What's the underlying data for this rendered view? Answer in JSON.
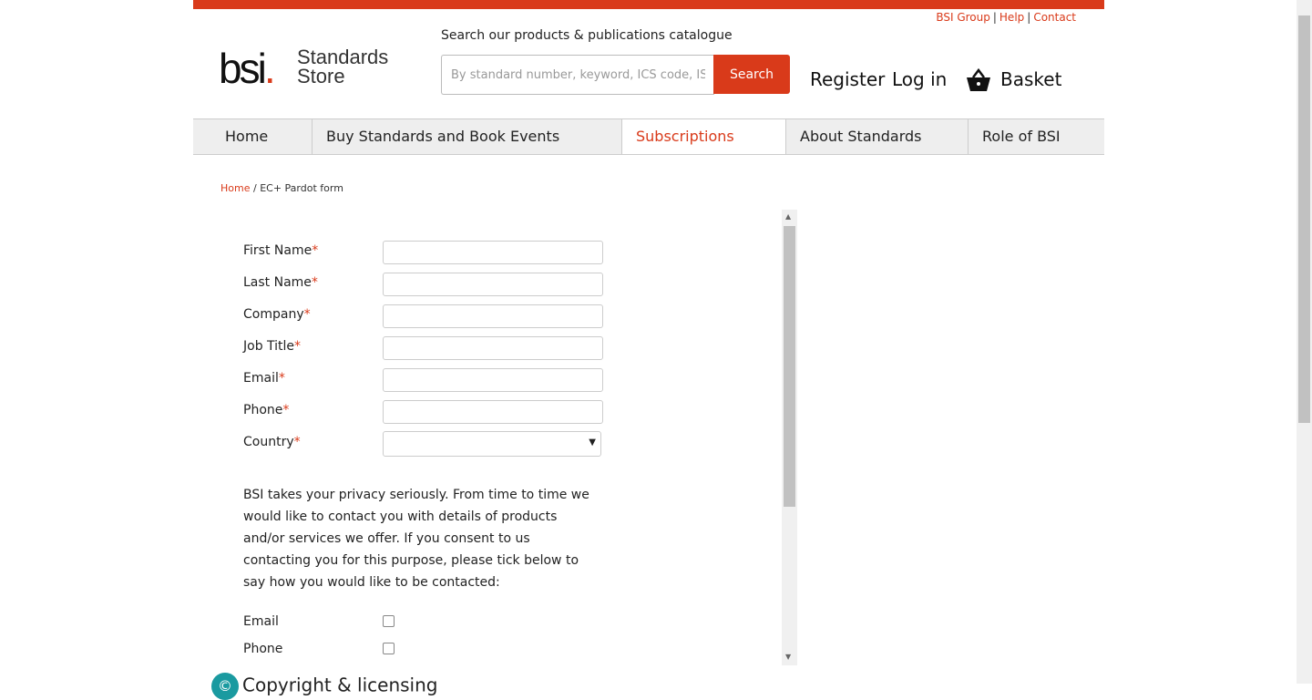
{
  "top_links": [
    "BSI Group",
    "Help",
    "Contact"
  ],
  "logo": {
    "bsi": "bsi",
    "dot": ".",
    "line1": "Standards",
    "line2": "Store"
  },
  "search": {
    "label": "Search our products & publications catalogue",
    "placeholder": "By standard number, keyword, ICS code, ISBN",
    "button": "Search"
  },
  "account": {
    "register": "Register",
    "login": "Log in",
    "basket": "Basket"
  },
  "nav": [
    "Home",
    "Buy Standards and Book Events",
    "Subscriptions",
    "About Standards",
    "Role of BSI"
  ],
  "nav_active": "Subscriptions",
  "breadcrumb": {
    "home": "Home",
    "sep": "/",
    "current": "EC+ Pardot form"
  },
  "form": {
    "fields": [
      "First Name",
      "Last Name",
      "Company",
      "Job Title",
      "Email",
      "Phone",
      "Country"
    ],
    "required_mark": "*",
    "privacy_text": "BSI takes your privacy seriously. From time to time we would like to contact you with details of products and/or services we offer. If you consent to us contacting you for this purpose, please tick below to say how you would like to be contacted:",
    "contact_options": [
      "Email",
      "Phone"
    ]
  },
  "footer": {
    "copyright_title": "Copyright & licensing",
    "icon_glyph": "©"
  },
  "colors": {
    "accent": "#d93a1a",
    "nav_bg": "#eeeeee",
    "copyright_icon": "#1a9aa0"
  },
  "icons": {
    "basket": "basket-icon",
    "select_caret": "chevron-down-icon"
  }
}
